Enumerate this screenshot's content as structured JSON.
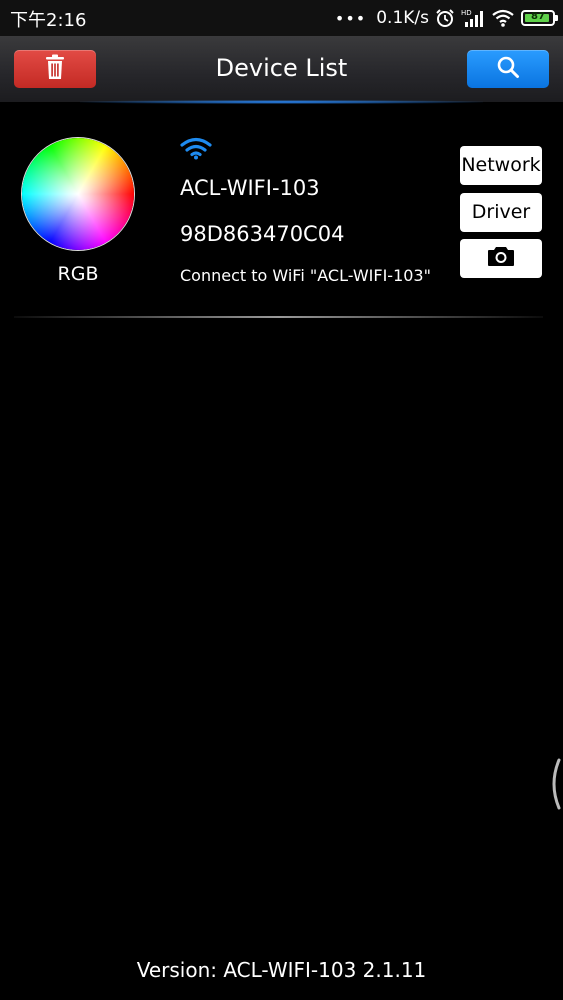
{
  "status_bar": {
    "time": "下午2:16",
    "dots": "•••",
    "net_speed": "0.1K/s",
    "battery_level": "87",
    "battery_color": "#5fd14a"
  },
  "header": {
    "title": "Device List",
    "delete_icon": "trash-icon",
    "search_icon": "search-icon",
    "delete_color": "#d9352f",
    "search_color": "#1a86f0"
  },
  "devices": [
    {
      "type": "RGB",
      "name": "ACL-WIFI-103",
      "mac": "98D863470C04",
      "hint": "Connect to WiFi \"ACL-WIFI-103\"",
      "wifi_icon": "wifi-icon",
      "network_label": "Network",
      "driver_label": "Driver",
      "camera_icon": "camera-icon"
    }
  ],
  "footer": {
    "version": "Version: ACL-WIFI-103  2.1.11"
  }
}
